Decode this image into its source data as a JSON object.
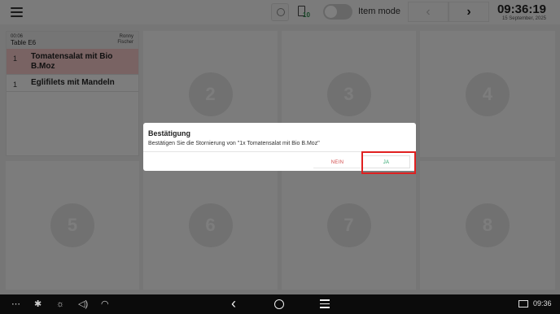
{
  "topbar": {
    "menu_icon": "hamburger-icon",
    "search_icon": "search-icon",
    "receipt_icon": "receipt-icon",
    "receipt_badge": "10",
    "item_mode_label": "Item mode",
    "item_mode_enabled": false,
    "prev_label": "‹",
    "next_label": "›",
    "clock_time": "09:36:19",
    "clock_date": "15 September, 2025"
  },
  "order_card": {
    "elapsed": "00:06",
    "table": "Table E6",
    "waiter_first": "Ronny",
    "waiter_last": "Fischer",
    "items": [
      {
        "qty": "1",
        "name": "Tomatensalat mit Bio B.Moz",
        "selected": true
      },
      {
        "qty": "1",
        "name": "Eglifilets mit Mandeln",
        "selected": false
      }
    ]
  },
  "tables": [
    "2",
    "3",
    "4",
    "5",
    "6",
    "7",
    "8"
  ],
  "dialog": {
    "title": "Bestätigung",
    "message": "Bestätigen Sie die Stornierung von \"1x Tomatensalat mit Bio B.Moz\"",
    "no_label": "NEIN",
    "yes_label": "JA"
  },
  "colors": {
    "selected_row": "#f3c6c6",
    "highlight": "#e02020",
    "yes": "#2aa46a",
    "no": "#d24a4a"
  },
  "navbar": {
    "icons": [
      "more-icon",
      "bluetooth-icon",
      "brightness-icon",
      "volume-icon",
      "wifi-icon"
    ],
    "time": "09:36"
  }
}
